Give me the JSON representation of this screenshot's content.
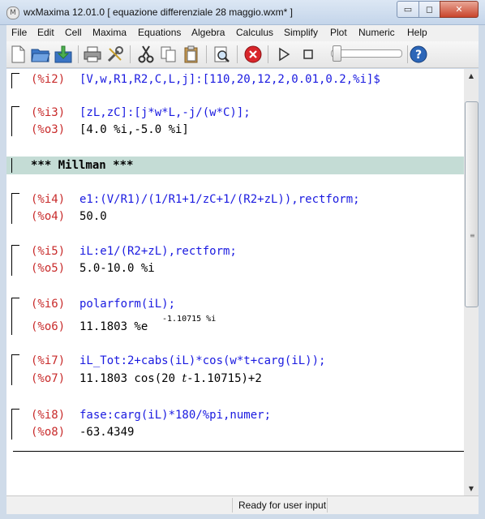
{
  "window": {
    "app_icon": "maxima-icon",
    "title": "wxMaxima 12.01.0  [ equazione differenziale 28 maggio.wxm* ]",
    "minimize_glyph": "▭",
    "maximize_glyph": "◻",
    "close_glyph": "✕"
  },
  "menu": [
    "File",
    "Edit",
    "Cell",
    "Maxima",
    "Equations",
    "Algebra",
    "Calculus",
    "Simplify",
    "Plot",
    "Numeric",
    "Help"
  ],
  "toolbar": {
    "icons": [
      "new-document-icon",
      "open-folder-icon",
      "save-icon",
      "print-icon",
      "preferences-icon",
      "cut-icon",
      "copy-icon",
      "paste-icon",
      "find-icon",
      "interrupt-icon",
      "play-icon",
      "stop-icon",
      "help-icon"
    ]
  },
  "cells": [
    {
      "in_label": "(%i2)",
      "in_text": "[V,w,R1,R2,C,L,j]:[110,20,12,2,0.01,0.2,%i]$"
    },
    {
      "in_label": "(%i3)",
      "in_text": "[zL,zC]:[j*w*L,-j/(w*C)];",
      "out_label": "(%o3)",
      "out_text": "[4.0 %i,-5.0 %i]"
    },
    {
      "section": "*** Millman ***"
    },
    {
      "in_label": "(%i4)",
      "in_text": "e1:(V/R1)/(1/R1+1/zC+1/(R2+zL)),rectform;",
      "out_label": "(%o4)",
      "out_text": "50.0"
    },
    {
      "in_label": "(%i5)",
      "in_text": "iL:e1/(R2+zL),rectform;",
      "out_label": "(%o5)",
      "out_text": "5.0-10.0 %i"
    },
    {
      "in_label": "(%i6)",
      "in_text": "polarform(iL);",
      "out_label": "(%o6)",
      "out_text": "11.1803 %e",
      "out_sup": "-1.10715 %i"
    },
    {
      "in_label": "(%i7)",
      "in_text": "iL_Tot:2+cabs(iL)*cos(w*t+carg(iL));",
      "out_label": "(%o7)",
      "out_text_a": "11.1803 cos(20 ",
      "out_text_t": "t",
      "out_text_b": "-1.10715)+2"
    },
    {
      "in_label": "(%i8)",
      "in_text": "fase:carg(iL)*180/%pi,numer;",
      "out_label": "(%o8)",
      "out_text": "-63.4349"
    }
  ],
  "status": "Ready for user input"
}
